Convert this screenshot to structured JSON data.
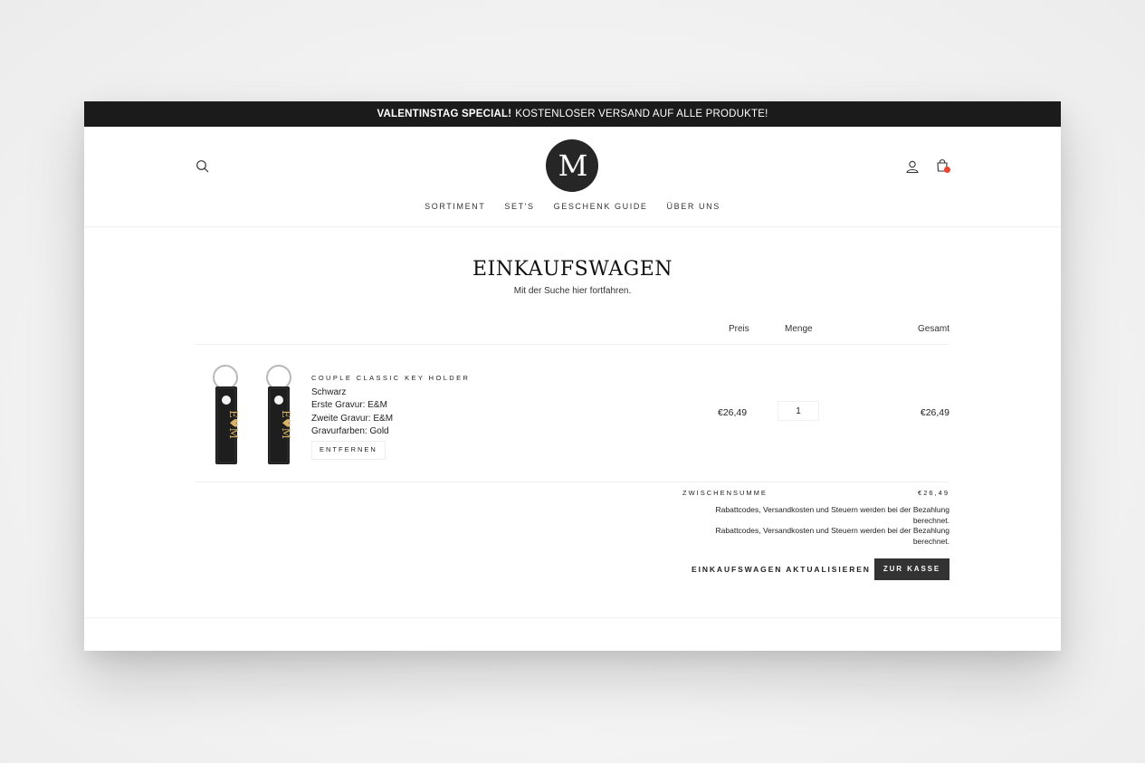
{
  "announcement": {
    "bold": "VALENTINSTAG SPECIAL!",
    "text": "KOSTENLOSER VERSAND AUF ALLE PRODUKTE!"
  },
  "header": {
    "logo_text": "M",
    "nav": [
      "SORTIMENT",
      "SET'S",
      "GESCHENK GUIDE",
      "ÜBER UNS"
    ],
    "icons": {
      "search": "search-icon",
      "account": "user-icon",
      "cart": "shopping-bag-icon"
    },
    "cart_badge_color": "#e8442f"
  },
  "page": {
    "title": "EINKAUFSWAGEN",
    "subtitle": "Mit der Suche hier fortfahren."
  },
  "table": {
    "headers": {
      "price": "Preis",
      "qty": "Menge",
      "total": "Gesamt"
    },
    "items": [
      {
        "title": "COUPLE CLASSIC KEY HOLDER",
        "variant": "Schwarz",
        "line1": "Erste Gravur: E&M",
        "line2": "Zweite Gravur: E&M",
        "line3": "Gravurfarben: Gold",
        "remove_label": "ENTFERNEN",
        "engraving_left": "E♥M",
        "engraving_right": "E♥M",
        "price": "€26,49",
        "qty": "1",
        "total": "€26,49"
      }
    ]
  },
  "summary": {
    "subtotal_label": "ZWISCHENSUMME",
    "subtotal_value": "€26,49",
    "note1": "Rabattcodes, Versandkosten und Steuern werden bei der Bezahlung berechnet.",
    "note2": "Rabattcodes, Versandkosten und Steuern werden bei der Bezahlung berechnet.",
    "update_label": "EINKAUFSWAGEN AKTUALISIEREN",
    "checkout_label": "ZUR KASSE"
  },
  "colors": {
    "announcement_bg": "#1b1b1b",
    "checkout_bg": "#333333",
    "accent": "#e8442f"
  }
}
